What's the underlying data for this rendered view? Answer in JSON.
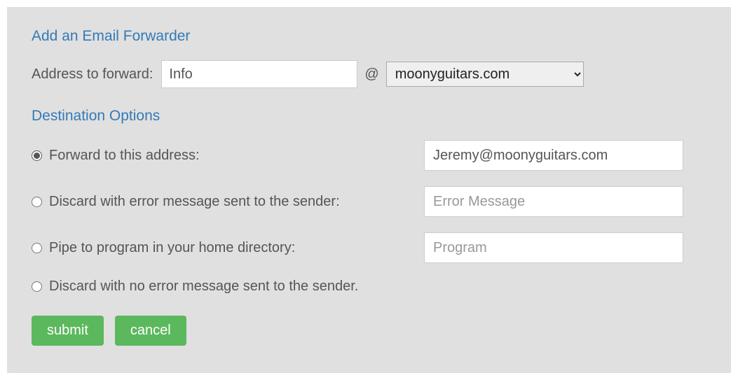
{
  "section1": {
    "title": "Add an Email Forwarder",
    "address_label": "Address to forward:",
    "address_value": "Info",
    "at_symbol": "@",
    "domain_selected": "moonyguitars.com"
  },
  "section2": {
    "title": "Destination Options",
    "options": [
      {
        "label": "Forward to this address:",
        "input_value": "Jeremy@moonyguitars.com",
        "input_placeholder": "",
        "checked": true
      },
      {
        "label": "Discard with error message sent to the sender:",
        "input_value": "",
        "input_placeholder": "Error Message",
        "checked": false
      },
      {
        "label": "Pipe to program in your home directory:",
        "input_value": "",
        "input_placeholder": "Program",
        "checked": false
      },
      {
        "label": "Discard with no error message sent to the sender.",
        "input_value": null,
        "input_placeholder": null,
        "checked": false
      }
    ]
  },
  "buttons": {
    "submit": "submit",
    "cancel": "cancel"
  }
}
